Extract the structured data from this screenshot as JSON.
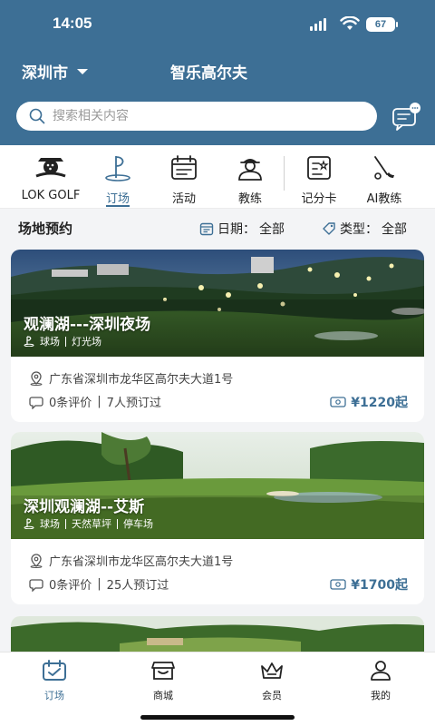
{
  "status": {
    "time": "14:05",
    "battery": "67"
  },
  "header": {
    "city": "深圳市",
    "title": "智乐高尔夫"
  },
  "search": {
    "placeholder": "搜索相关内容"
  },
  "categories": [
    {
      "label": "LOK GOLF",
      "icon": "golf-logo-icon"
    },
    {
      "label": "订场",
      "icon": "golf-flag-icon"
    },
    {
      "label": "活动",
      "icon": "calendar-icon"
    },
    {
      "label": "教练",
      "icon": "coach-icon"
    },
    {
      "label": "记分卡",
      "icon": "scorecard-icon"
    },
    {
      "label": "AI教练",
      "icon": "golf-club-icon"
    }
  ],
  "section": {
    "title": "场地预约",
    "date_label": "日期：",
    "date_value": "全部",
    "type_label": "类型：",
    "type_value": "全部"
  },
  "courses": [
    {
      "name": "观澜湖---深圳夜场",
      "tags": [
        "球场",
        "灯光场"
      ],
      "address": "广东省深圳市龙华区高尔夫大道1号",
      "reviews": "0条评价",
      "bookings": "7人预订过",
      "price": "¥1220起"
    },
    {
      "name": "深圳观澜湖--艾斯",
      "tags": [
        "球场",
        "天然草坪",
        "停车场"
      ],
      "address": "广东省深圳市龙华区高尔夫大道1号",
      "reviews": "0条评价",
      "bookings": "25人预订过",
      "price": "¥1700起"
    }
  ],
  "tabs": [
    {
      "label": "订场",
      "icon": "booking-icon"
    },
    {
      "label": "商城",
      "icon": "shop-icon"
    },
    {
      "label": "会员",
      "icon": "crown-icon"
    },
    {
      "label": "我的",
      "icon": "user-icon"
    }
  ],
  "colors": {
    "primary": "#3d6f95",
    "text": "#222222"
  }
}
